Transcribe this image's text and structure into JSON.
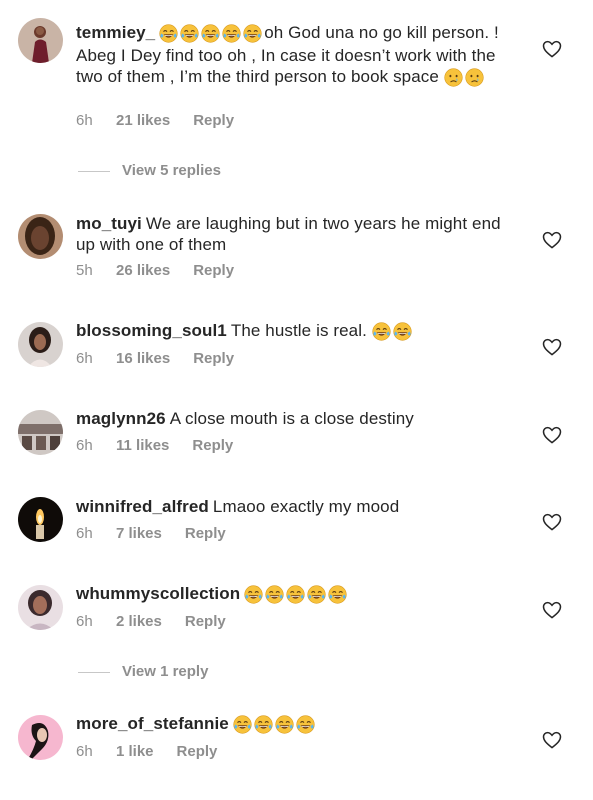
{
  "comments": [
    {
      "username": "temmiey_",
      "emojis_before": [
        "face-with-tears-of-joy",
        "face-with-tears-of-joy",
        "face-with-tears-of-joy",
        "face-with-tears-of-joy",
        "face-with-tears-of-joy"
      ],
      "text": "oh God una no go kill person. ! Abeg I Dey find too oh , In case it doesn’t work with the two of them , I’m the third person to book space",
      "emojis_after": [
        "crying-face",
        "crying-face"
      ],
      "time": "6h",
      "likes": "21 likes",
      "reply": "Reply",
      "view_replies": "View 5 replies"
    },
    {
      "username": "mo_tuyi",
      "text": "We are laughing but in two years he might end up with one of them",
      "time": "5h",
      "likes": "26 likes",
      "reply": "Reply"
    },
    {
      "username": "blossoming_soul1",
      "text": "The hustle is real.",
      "emojis_after": [
        "face-with-tears-of-joy",
        "face-with-tears-of-joy"
      ],
      "time": "6h",
      "likes": "16 likes",
      "reply": "Reply"
    },
    {
      "username": "maglynn26",
      "text": "A close mouth is a close destiny",
      "time": "6h",
      "likes": "11 likes",
      "reply": "Reply"
    },
    {
      "username": "winnifred_alfred",
      "text": "Lmaoo exactly my mood",
      "time": "6h",
      "likes": "7 likes",
      "reply": "Reply"
    },
    {
      "username": "whummyscollection",
      "text": "",
      "emojis_after": [
        "face-with-tears-of-joy",
        "face-with-tears-of-joy",
        "face-with-tears-of-joy",
        "face-with-tears-of-joy",
        "face-with-tears-of-joy"
      ],
      "time": "6h",
      "likes": "2 likes",
      "reply": "Reply",
      "view_replies": "View 1 reply"
    },
    {
      "username": "more_of_stefannie",
      "text": "",
      "emojis_after": [
        "face-with-tears-of-joy",
        "face-with-tears-of-joy",
        "face-with-tears-of-joy",
        "face-with-tears-of-joy"
      ],
      "time": "6h",
      "likes": "1 like",
      "reply": "Reply"
    }
  ],
  "icons": {
    "like": "heart-outline-icon",
    "avatar": "profile-photo"
  },
  "colors": {
    "text": "#262626",
    "secondary": "#8e8e8e",
    "divider": "#c7c7c7",
    "emoji_face": "#f7c23b"
  }
}
